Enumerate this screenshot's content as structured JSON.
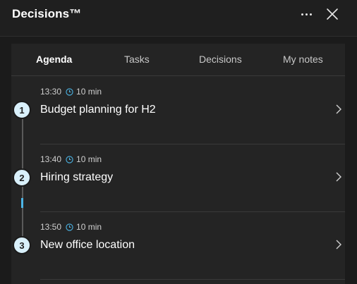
{
  "app": {
    "title": "Decisions™"
  },
  "header": {
    "more_icon": "more-horizontal-icon",
    "close_icon": "close-icon"
  },
  "tabs": [
    {
      "label": "Agenda",
      "active": true
    },
    {
      "label": "Tasks",
      "active": false
    },
    {
      "label": "Decisions",
      "active": false
    },
    {
      "label": "My notes",
      "active": false
    }
  ],
  "agenda": {
    "items": [
      {
        "number": "1",
        "time": "13:30",
        "duration": "10 min",
        "title": "Budget planning for H2"
      },
      {
        "number": "2",
        "time": "13:40",
        "duration": "10 min",
        "title": "Hiring strategy"
      },
      {
        "number": "3",
        "time": "13:50",
        "duration": "10 min",
        "title": "New office location"
      }
    ]
  },
  "colors": {
    "accent": "#4cb5e6",
    "badge_fill": "#d9f0fb",
    "background": "#1f1f1f",
    "panel": "#242424"
  }
}
